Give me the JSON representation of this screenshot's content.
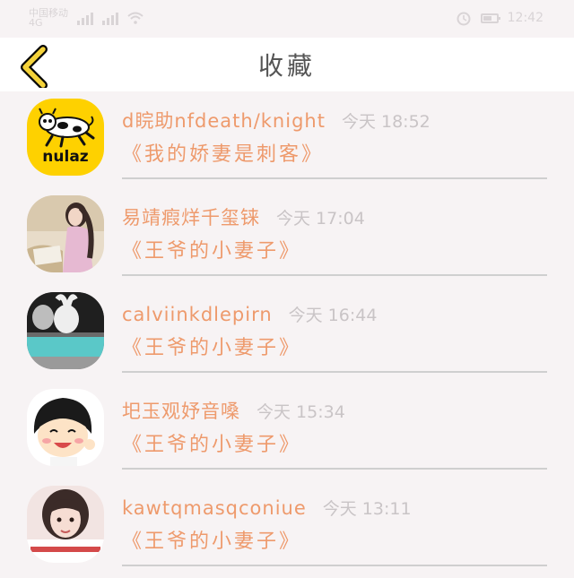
{
  "status_bar": {
    "carrier_line1": "中国移动",
    "carrier_line2": "4G",
    "time": "12:42",
    "battery_percent": 70
  },
  "nav": {
    "title": "收藏"
  },
  "items": [
    {
      "user": "d睆助nfdeath/knight",
      "time": "今天  18:52",
      "book": "《我的娇妻是刺客》",
      "avatar_logo_text": "nulaz"
    },
    {
      "user": "易靖瘕烊千玺铼",
      "time": "今天  17:04",
      "book": "《王爷的小妻子》"
    },
    {
      "user": "calviinkdlepirn",
      "time": "今天  16:44",
      "book": "《王爷的小妻子》"
    },
    {
      "user": "圯玉观妤音嗓",
      "time": "今天  15:34",
      "book": "《王爷的小妻子》"
    },
    {
      "user": "kawtqmasqconiue",
      "time": "今天  13:11",
      "book": "《王爷的小妻子》"
    }
  ],
  "colors": {
    "accent": "#ee9a6c",
    "time": "#c9c4c6",
    "back_arrow": "#f4d23a",
    "background": "#f7f3f4"
  }
}
